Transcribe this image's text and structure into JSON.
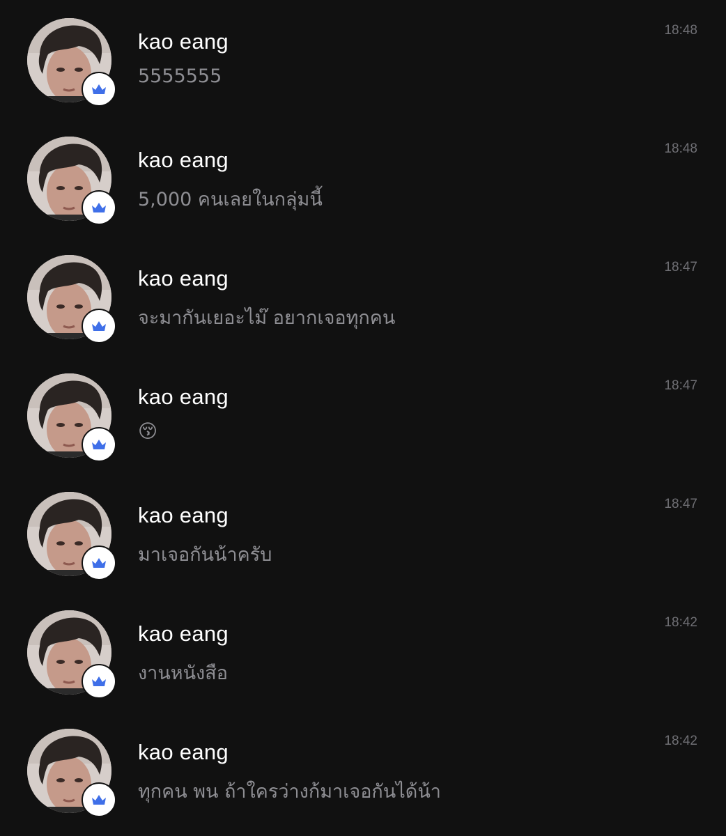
{
  "chats": [
    {
      "name": "kao eang",
      "message": "5555555",
      "time": "18:48",
      "badge_icon": "crown-icon"
    },
    {
      "name": "kao eang",
      "message": "5,000 คนเลยในกลุ่มนี้",
      "time": "18:48",
      "badge_icon": "crown-icon"
    },
    {
      "name": "kao eang",
      "message": "จะมากันเยอะไม๊ อยากเจอทุกคน",
      "time": "18:47",
      "badge_icon": "crown-icon"
    },
    {
      "name": "kao eang",
      "message": "😚",
      "time": "18:47",
      "badge_icon": "crown-icon"
    },
    {
      "name": "kao eang",
      "message": "มาเจอกันน้าครับ",
      "time": "18:47",
      "badge_icon": "crown-icon"
    },
    {
      "name": "kao eang",
      "message": "งานหนังสือ",
      "time": "18:42",
      "badge_icon": "crown-icon"
    },
    {
      "name": "kao eang",
      "message": "ทุกคน พน ถ้าใครว่างก้มาเจอกันได้น้า",
      "time": "18:42",
      "badge_icon": "crown-icon"
    }
  ],
  "colors": {
    "background": "#111111",
    "name_text": "#ffffff",
    "message_text": "#8e8e93",
    "time_text": "#6f6f74",
    "badge_accent": "#3f6fe8"
  }
}
